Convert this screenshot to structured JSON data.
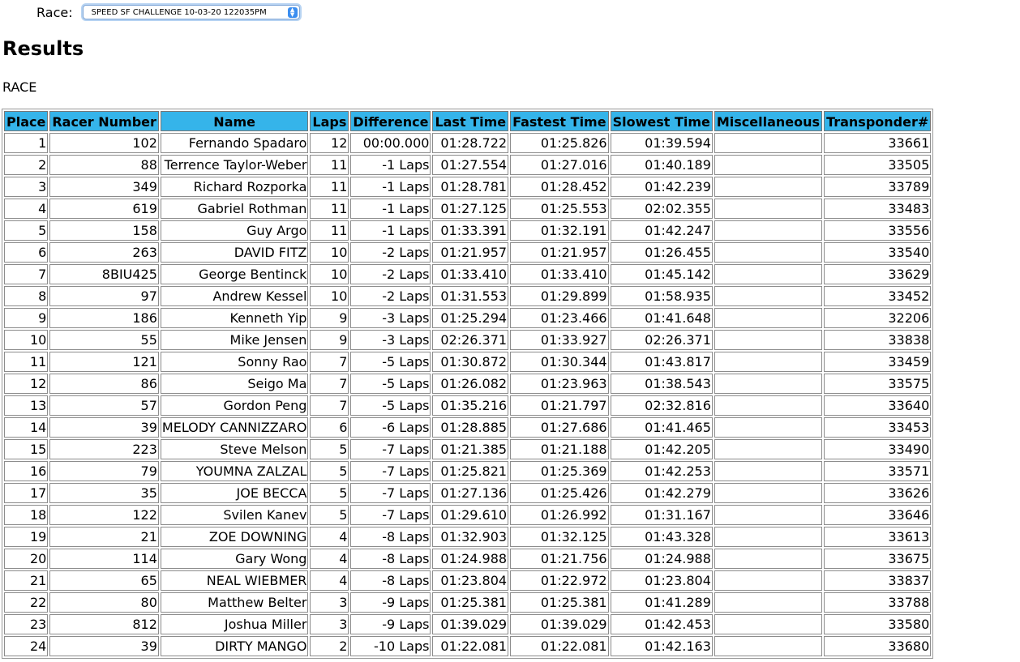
{
  "race_selector": {
    "label": "Race:",
    "selected": "SPEED SF CHALLENGE 10-03-20 122035PM"
  },
  "heading": "Results",
  "subheading": "RACE",
  "table": {
    "columns": [
      "Place",
      "Racer Number",
      "Name",
      "Laps",
      "Difference",
      "Last Time",
      "Fastest Time",
      "Slowest Time",
      "Miscellaneous",
      "Transponder#"
    ],
    "rows": [
      [
        "1",
        "102",
        "Fernando Spadaro",
        "12",
        "00:00.000",
        "01:28.722",
        "01:25.826",
        "01:39.594",
        "",
        "33661"
      ],
      [
        "2",
        "88",
        "Terrence Taylor-Weber",
        "11",
        "-1 Laps",
        "01:27.554",
        "01:27.016",
        "01:40.189",
        "",
        "33505"
      ],
      [
        "3",
        "349",
        "Richard Rozporka",
        "11",
        "-1 Laps",
        "01:28.781",
        "01:28.452",
        "01:42.239",
        "",
        "33789"
      ],
      [
        "4",
        "619",
        "Gabriel Rothman",
        "11",
        "-1 Laps",
        "01:27.125",
        "01:25.553",
        "02:02.355",
        "",
        "33483"
      ],
      [
        "5",
        "158",
        "Guy Argo",
        "11",
        "-1 Laps",
        "01:33.391",
        "01:32.191",
        "01:42.247",
        "",
        "33556"
      ],
      [
        "6",
        "263",
        "DAVID FITZ",
        "10",
        "-2 Laps",
        "01:21.957",
        "01:21.957",
        "01:26.455",
        "",
        "33540"
      ],
      [
        "7",
        "8BIU425",
        "George Bentinck",
        "10",
        "-2 Laps",
        "01:33.410",
        "01:33.410",
        "01:45.142",
        "",
        "33629"
      ],
      [
        "8",
        "97",
        "Andrew Kessel",
        "10",
        "-2 Laps",
        "01:31.553",
        "01:29.899",
        "01:58.935",
        "",
        "33452"
      ],
      [
        "9",
        "186",
        "Kenneth Yip",
        "9",
        "-3 Laps",
        "01:25.294",
        "01:23.466",
        "01:41.648",
        "",
        "32206"
      ],
      [
        "10",
        "55",
        "Mike Jensen",
        "9",
        "-3 Laps",
        "02:26.371",
        "01:33.927",
        "02:26.371",
        "",
        "33838"
      ],
      [
        "11",
        "121",
        "Sonny Rao",
        "7",
        "-5 Laps",
        "01:30.872",
        "01:30.344",
        "01:43.817",
        "",
        "33459"
      ],
      [
        "12",
        "86",
        "Seigo Ma",
        "7",
        "-5 Laps",
        "01:26.082",
        "01:23.963",
        "01:38.543",
        "",
        "33575"
      ],
      [
        "13",
        "57",
        "Gordon Peng",
        "7",
        "-5 Laps",
        "01:35.216",
        "01:21.797",
        "02:32.816",
        "",
        "33640"
      ],
      [
        "14",
        "39",
        "MELODY CANNIZZARO",
        "6",
        "-6 Laps",
        "01:28.885",
        "01:27.686",
        "01:41.465",
        "",
        "33453"
      ],
      [
        "15",
        "223",
        "Steve Melson",
        "5",
        "-7 Laps",
        "01:21.385",
        "01:21.188",
        "01:42.205",
        "",
        "33490"
      ],
      [
        "16",
        "79",
        "YOUMNA ZALZAL",
        "5",
        "-7 Laps",
        "01:25.821",
        "01:25.369",
        "01:42.253",
        "",
        "33571"
      ],
      [
        "17",
        "35",
        "JOE BECCA",
        "5",
        "-7 Laps",
        "01:27.136",
        "01:25.426",
        "01:42.279",
        "",
        "33626"
      ],
      [
        "18",
        "122",
        "Svilen Kanev",
        "5",
        "-7 Laps",
        "01:29.610",
        "01:26.992",
        "01:31.167",
        "",
        "33646"
      ],
      [
        "19",
        "21",
        "ZOE DOWNING",
        "4",
        "-8 Laps",
        "01:32.903",
        "01:32.125",
        "01:43.328",
        "",
        "33613"
      ],
      [
        "20",
        "114",
        "Gary Wong",
        "4",
        "-8 Laps",
        "01:24.988",
        "01:21.756",
        "01:24.988",
        "",
        "33675"
      ],
      [
        "21",
        "65",
        "NEAL WIEBMER",
        "4",
        "-8 Laps",
        "01:23.804",
        "01:22.972",
        "01:23.804",
        "",
        "33837"
      ],
      [
        "22",
        "80",
        "Matthew Belter",
        "3",
        "-9 Laps",
        "01:25.381",
        "01:25.381",
        "01:41.289",
        "",
        "33788"
      ],
      [
        "23",
        "812",
        "Joshua Miller",
        "3",
        "-9 Laps",
        "01:39.029",
        "01:39.029",
        "01:42.453",
        "",
        "33580"
      ],
      [
        "24",
        "39",
        "DIRTY MANGO",
        "2",
        "-10 Laps",
        "01:22.081",
        "01:22.081",
        "01:42.163",
        "",
        "33680"
      ]
    ]
  },
  "colors": {
    "header_bg": "#35b4ea",
    "select_accent": "#3b8ef0"
  },
  "icons": {
    "select_arrows": "chevron-updown-icon"
  }
}
